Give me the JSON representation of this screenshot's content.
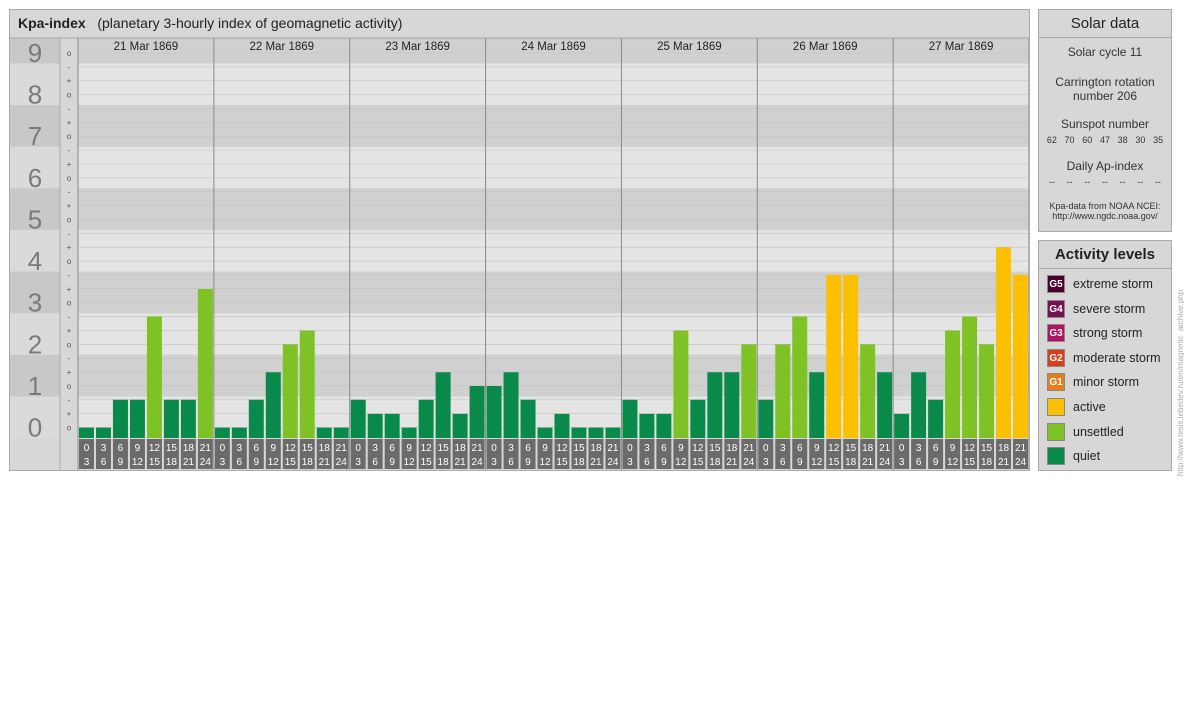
{
  "header": {
    "title": "Kpa-index",
    "subtitle": "(planetary 3-hourly index of geomagnetic activity)"
  },
  "chart_data": {
    "type": "bar",
    "title": "Kpa-index",
    "subtitle": "(planetary 3-hourly index of geomagnetic activity)",
    "ylim": [
      0,
      9
    ],
    "y_ticks": [
      "0",
      "1",
      "2",
      "3",
      "4",
      "5",
      "6",
      "7",
      "8",
      "9"
    ],
    "y_subticks": [
      "o",
      "-",
      "+"
    ],
    "days": [
      "21 Mar 1869",
      "22 Mar 1869",
      "23 Mar 1869",
      "24 Mar 1869",
      "25 Mar 1869",
      "26 Mar 1869",
      "27 Mar 1869"
    ],
    "interval_start_hours": [
      "0",
      "3",
      "6",
      "9",
      "12",
      "15",
      "18",
      "21"
    ],
    "interval_end_hours": [
      "3",
      "6",
      "9",
      "12",
      "15",
      "18",
      "21",
      "24"
    ],
    "values": [
      [
        0.0,
        0.0,
        0.67,
        0.67,
        2.67,
        0.67,
        0.67,
        3.33
      ],
      [
        0.0,
        0.0,
        0.67,
        1.33,
        2.0,
        2.33,
        0.0,
        0.0
      ],
      [
        0.67,
        0.33,
        0.33,
        0.0,
        0.67,
        1.33,
        0.33,
        1.0
      ],
      [
        1.0,
        1.33,
        0.67,
        0.0,
        0.33,
        0.0,
        0.0,
        0.0
      ],
      [
        0.67,
        0.33,
        0.33,
        2.33,
        0.67,
        1.33,
        1.33,
        2.0
      ],
      [
        0.67,
        2.0,
        2.67,
        1.33,
        3.67,
        3.67,
        2.0,
        1.33
      ],
      [
        0.33,
        1.33,
        0.67,
        2.33,
        2.67,
        2.0,
        4.33,
        3.67
      ]
    ],
    "color_thresholds": [
      {
        "max": 2.99,
        "level": "quiet-unsettled"
      },
      {
        "min": 3.0,
        "max": 4.99,
        "level": "active"
      }
    ],
    "colors": {
      "quiet": "#0a8a4a",
      "unsettled": "#7ec226",
      "active": "#fbc000",
      "minor storm": "#e87d1e",
      "moderate storm": "#d93e1d",
      "strong storm": "#b2135f",
      "severe storm": "#761251",
      "extreme storm": "#4d0029"
    }
  },
  "solar": {
    "title": "Solar data",
    "cycle": "Solar cycle 11",
    "carrington_line1": "Carrington rotation",
    "carrington_line2": "number 206",
    "sunspot_title": "Sunspot number",
    "sunspots": [
      "62",
      "70",
      "60",
      "47",
      "38",
      "30",
      "35"
    ],
    "ap_title": "Daily Ap-index",
    "ap_values": [
      "--",
      "--",
      "--",
      "--",
      "--",
      "--",
      "--"
    ],
    "source_line1": "Kpa-data from NOAA NCEI:",
    "source_line2": "http://www.ngdc.noaa.gov/"
  },
  "legend": {
    "title": "Activity levels",
    "items": [
      {
        "badge": "G5",
        "label": "extreme storm",
        "color": "#4d0029"
      },
      {
        "badge": "G4",
        "label": "severe storm",
        "color": "#761251"
      },
      {
        "badge": "G3",
        "label": "strong storm",
        "color": "#b2135f"
      },
      {
        "badge": "G2",
        "label": "moderate storm",
        "color": "#d93e1d"
      },
      {
        "badge": "G1",
        "label": "minor storm",
        "color": "#e87d1e"
      },
      {
        "badge": "",
        "label": "active",
        "color": "#fbc000"
      },
      {
        "badge": "",
        "label": "unsettled",
        "color": "#7ec226"
      },
      {
        "badge": "",
        "label": "quiet",
        "color": "#0a8a4a"
      }
    ]
  },
  "credit": "http://www.tesis.lebedev.ru/en/magnetic_archive.php"
}
